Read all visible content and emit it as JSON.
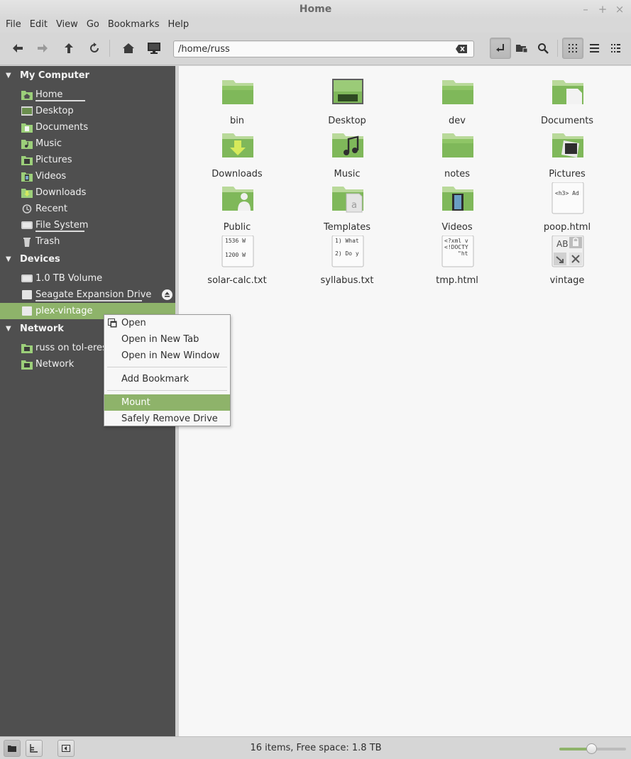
{
  "window": {
    "title": "Home"
  },
  "menubar": [
    "File",
    "Edit",
    "View",
    "Go",
    "Bookmarks",
    "Help"
  ],
  "toolbar": {
    "location_value": "/home/russ",
    "buttons": [
      "back-icon",
      "forward-icon",
      "up-icon",
      "refresh-icon",
      "home-icon",
      "computer-icon",
      "toggle-location-icon",
      "new-folder-icon",
      "search-icon",
      "icon-view-icon",
      "list-view-icon",
      "compact-view-icon"
    ]
  },
  "sidebar": {
    "sections": [
      {
        "title": "My Computer",
        "items": [
          "Home",
          "Desktop",
          "Documents",
          "Music",
          "Pictures",
          "Videos",
          "Downloads",
          "Recent",
          "File System",
          "Trash"
        ]
      },
      {
        "title": "Devices",
        "items": [
          "1.0 TB Volume",
          "Seagate Expansion Drive",
          "plex-vintage"
        ]
      },
      {
        "title": "Network",
        "items": [
          "russ on tol-eressea",
          "Network"
        ]
      }
    ],
    "selected": "plex-vintage"
  },
  "files": [
    {
      "name": "bin",
      "icon": "folder-icon"
    },
    {
      "name": "Desktop",
      "icon": "desktop-folder-icon"
    },
    {
      "name": "dev",
      "icon": "folder-icon"
    },
    {
      "name": "Documents",
      "icon": "documents-folder-icon"
    },
    {
      "name": "Downloads",
      "icon": "downloads-folder-icon"
    },
    {
      "name": "Music",
      "icon": "music-folder-icon"
    },
    {
      "name": "notes",
      "icon": "folder-icon"
    },
    {
      "name": "Pictures",
      "icon": "pictures-folder-icon"
    },
    {
      "name": "Public",
      "icon": "public-folder-icon"
    },
    {
      "name": "Templates",
      "icon": "templates-folder-icon"
    },
    {
      "name": "Videos",
      "icon": "videos-folder-icon"
    },
    {
      "name": "poop.html",
      "icon": "html-file-icon",
      "preview": [
        "<h3> Ad"
      ]
    },
    {
      "name": "solar-calc.txt",
      "icon": "text-file-icon",
      "preview": [
        "1536 W",
        "1200 W"
      ]
    },
    {
      "name": "syllabus.txt",
      "icon": "text-file-icon",
      "preview": [
        "1) What",
        "2) Do y"
      ]
    },
    {
      "name": "tmp.html",
      "icon": "html-file-icon",
      "preview": [
        "<?xml v",
        "<!DOCTY",
        "\"ht"
      ]
    },
    {
      "name": "vintage",
      "icon": "locked-folder-icon"
    }
  ],
  "context_menu": {
    "items": [
      "Open",
      "Open in New Tab",
      "Open in New Window",
      "Add Bookmark",
      "Mount",
      "Safely Remove Drive"
    ],
    "highlighted": "Mount"
  },
  "statusbar": {
    "text": "16 items, Free space: 1.8 TB",
    "zoom_fraction": 0.5
  },
  "colors": {
    "accent": "#8eb36a",
    "sidebar_bg": "#4f4f4f",
    "main_bg": "#f7f7f7"
  }
}
